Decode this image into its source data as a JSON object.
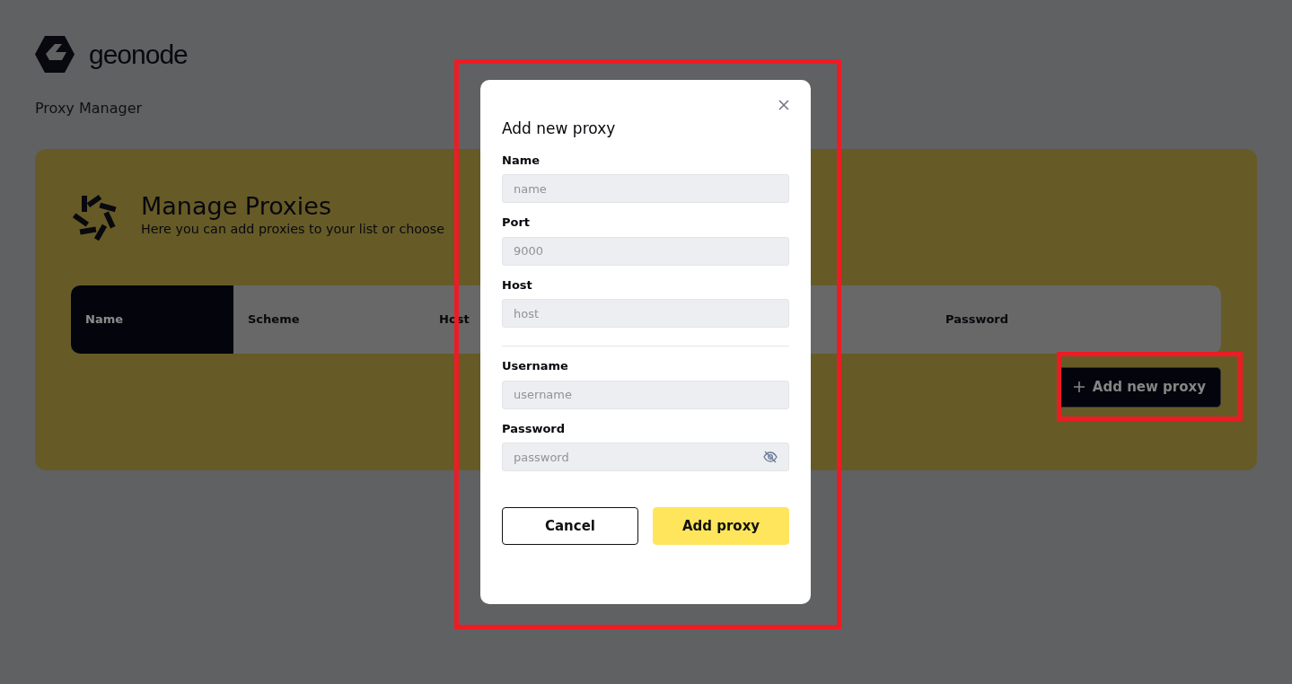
{
  "app": {
    "logo_text": "geonode",
    "page_title": "Proxy Manager"
  },
  "card": {
    "title": "Manage Proxies",
    "subtitle": "Here you can add proxies to your list or choose",
    "columns": [
      {
        "label": "Name",
        "selected": true
      },
      {
        "label": "Scheme",
        "selected": false
      },
      {
        "label": "Host",
        "selected": false
      },
      {
        "label": "Password",
        "selected": false
      }
    ],
    "add_button": {
      "label": "Add new proxy",
      "highlighted": true
    }
  },
  "modal": {
    "title": "Add new proxy",
    "highlighted": true,
    "sections": [
      {
        "fields": [
          {
            "label": "Name",
            "placeholder": "name",
            "kind": "text"
          },
          {
            "label": "Port",
            "placeholder": "9000",
            "kind": "text"
          },
          {
            "label": "Host",
            "placeholder": "host",
            "kind": "text"
          }
        ]
      },
      {
        "fields": [
          {
            "label": "Username",
            "placeholder": "username",
            "kind": "text"
          },
          {
            "label": "Password",
            "placeholder": "password",
            "kind": "password"
          }
        ]
      }
    ],
    "buttons": [
      {
        "label": "Cancel",
        "kind": "secondary"
      },
      {
        "label": "Add proxy",
        "kind": "primary"
      }
    ]
  }
}
